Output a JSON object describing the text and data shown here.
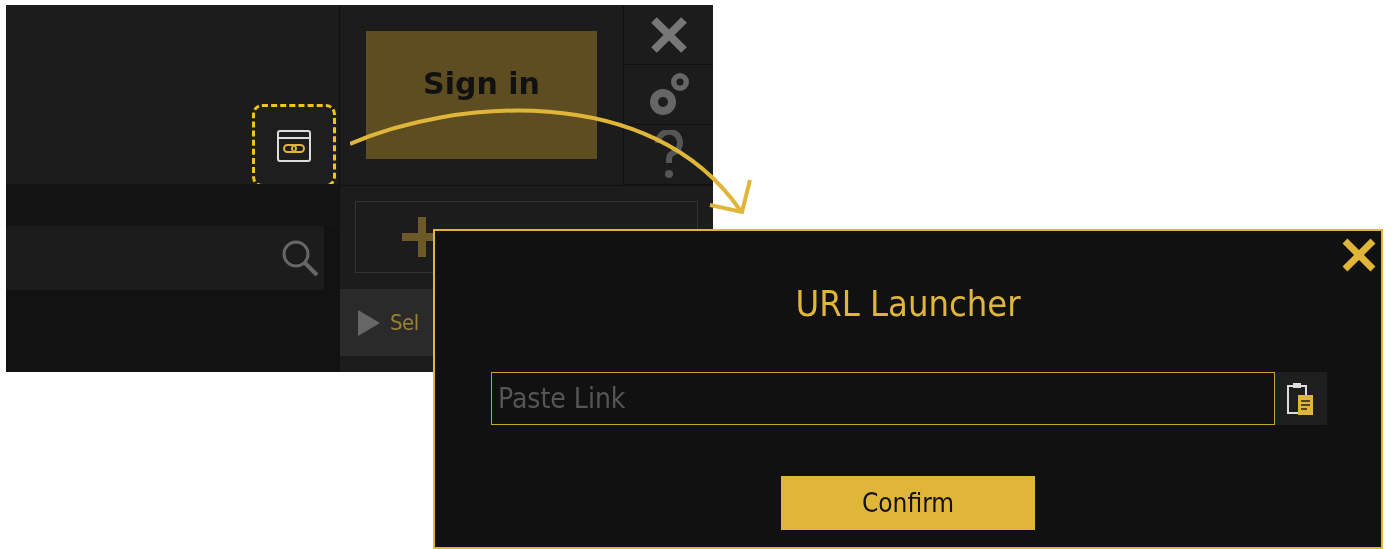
{
  "app": {
    "sign_in": "Sign in",
    "select_button": "Sel"
  },
  "dialog": {
    "title": "URL Launcher",
    "link_field": {
      "placeholder": "Paste Link"
    },
    "confirm": "Confirm"
  }
}
